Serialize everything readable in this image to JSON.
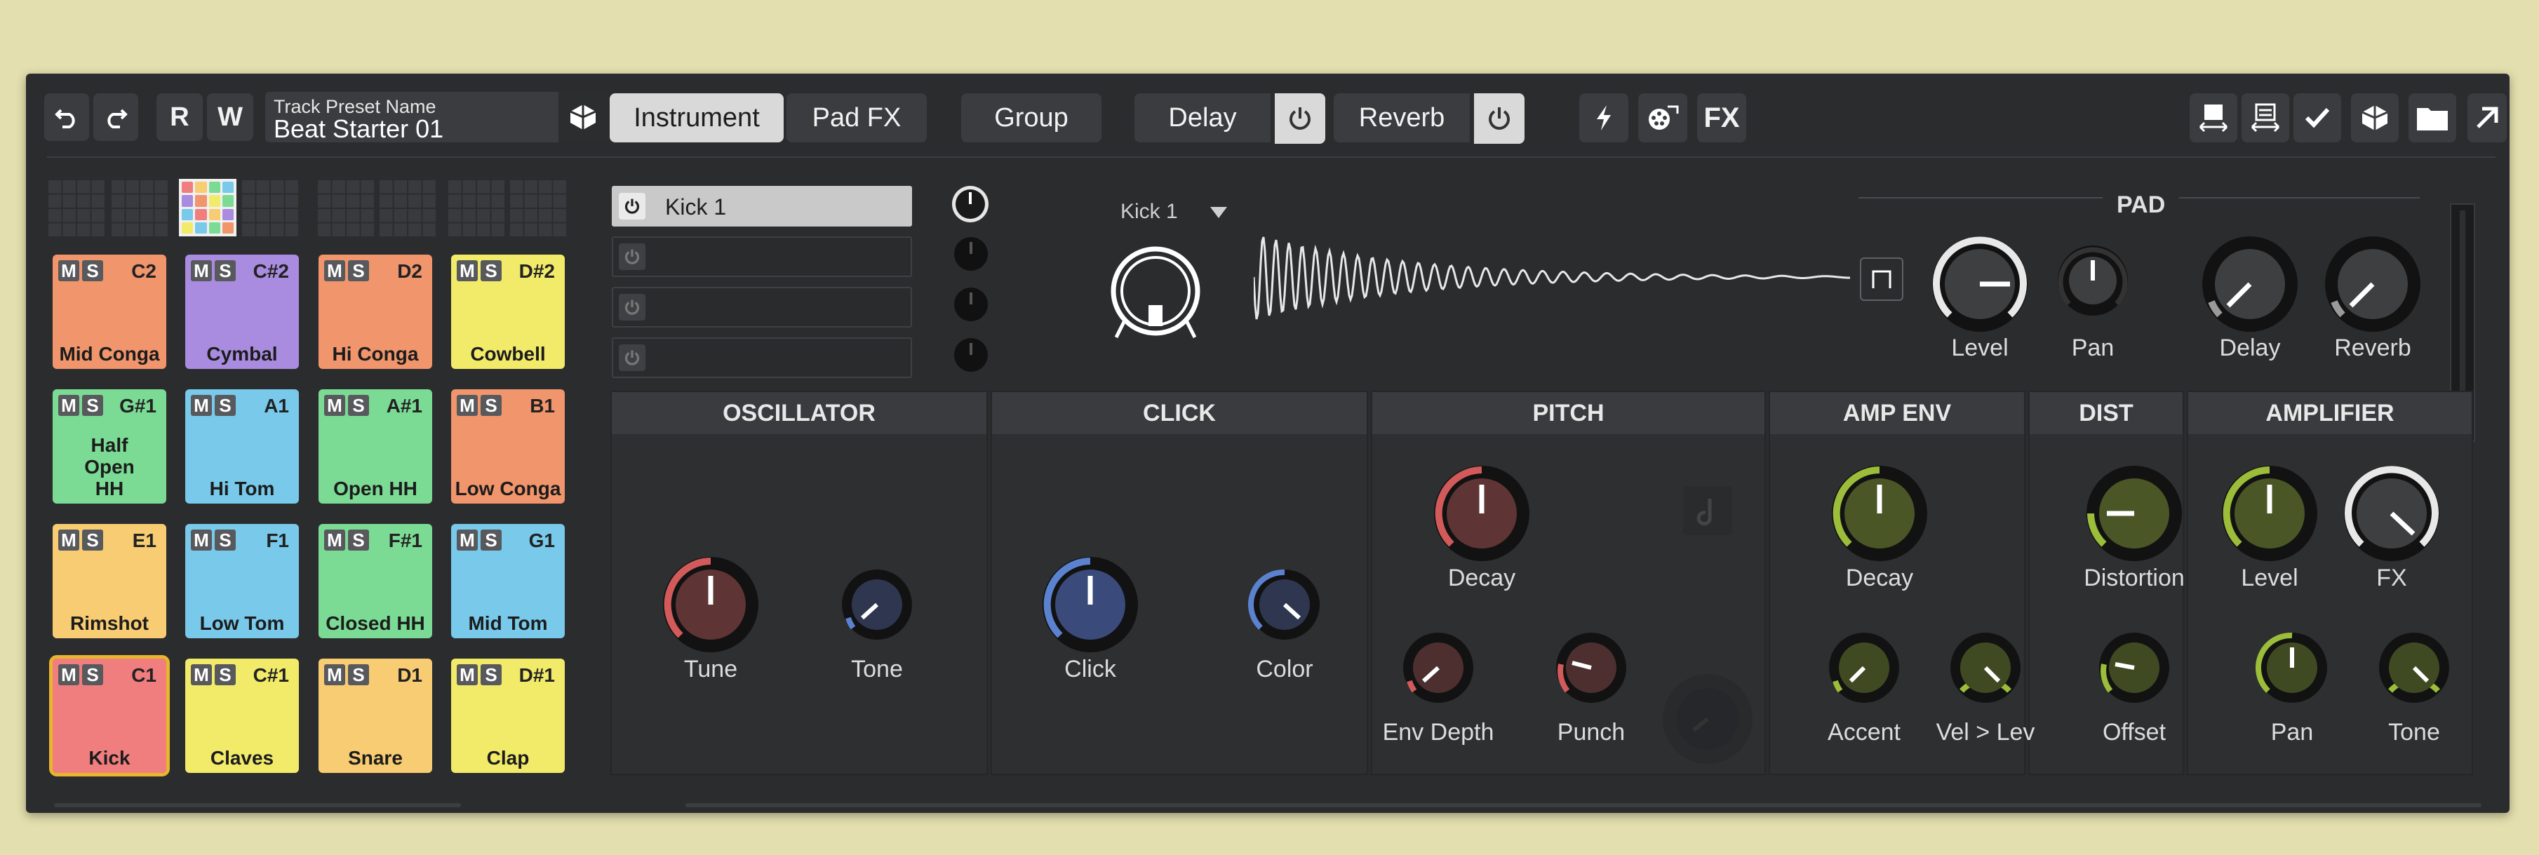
{
  "toolbar": {
    "undo_icon": "undo-icon",
    "redo_icon": "redo-icon",
    "r_label": "R",
    "w_label": "W",
    "preset_label": "Track Preset Name",
    "preset_value": "Beat Starter 01",
    "tabs": [
      "Instrument",
      "Pad FX",
      "Group",
      "Delay",
      "Reverb"
    ],
    "selected_tab": "Instrument",
    "fx_label": "FX"
  },
  "pads": [
    {
      "note": "C2",
      "name": "Mid Conga",
      "color": "#f0956c"
    },
    {
      "note": "C#2",
      "name": "Cymbal",
      "color": "#a98cdf"
    },
    {
      "note": "D2",
      "name": "Hi Conga",
      "color": "#f0956c"
    },
    {
      "note": "D#2",
      "name": "Cowbell",
      "color": "#f2eb6a"
    },
    {
      "note": "G#1",
      "name": "Half Open HH",
      "color": "#7bdb94"
    },
    {
      "note": "A1",
      "name": "Hi Tom",
      "color": "#78c9ea"
    },
    {
      "note": "A#1",
      "name": "Open HH",
      "color": "#7bdb94"
    },
    {
      "note": "B1",
      "name": "Low Conga",
      "color": "#f0956c"
    },
    {
      "note": "E1",
      "name": "Rimshot",
      "color": "#f7cc72"
    },
    {
      "note": "F1",
      "name": "Low Tom",
      "color": "#78c9ea"
    },
    {
      "note": "F#1",
      "name": "Closed HH",
      "color": "#7bdb94"
    },
    {
      "note": "G1",
      "name": "Mid Tom",
      "color": "#78c9ea"
    },
    {
      "note": "C1",
      "name": "Kick",
      "color": "#f07e7e"
    },
    {
      "note": "C#1",
      "name": "Claves",
      "color": "#f2eb6a"
    },
    {
      "note": "D1",
      "name": "Snare",
      "color": "#f7cc72"
    },
    {
      "note": "D#1",
      "name": "Clap",
      "color": "#f2eb6a"
    }
  ],
  "pad_ms": {
    "m": "M",
    "s": "S"
  },
  "active_pad": "Kick",
  "layers": [
    "Kick 1",
    "",
    "",
    ""
  ],
  "instrument": {
    "name": "Kick 1",
    "pad_section": "PAD",
    "pad_knobs": [
      "Level",
      "Pan",
      "Delay",
      "Reverb"
    ]
  },
  "sections": {
    "oscillator": {
      "title": "OSCILLATOR",
      "knobs": [
        "Tune",
        "Tone"
      ]
    },
    "click": {
      "title": "CLICK",
      "knobs": [
        "Click",
        "Color"
      ]
    },
    "pitch": {
      "title": "PITCH",
      "knobs": [
        "Decay",
        "Env Depth",
        "Punch"
      ]
    },
    "amp_env": {
      "title": "AMP ENV",
      "knobs": [
        "Decay",
        "Accent",
        "Vel > Lev"
      ]
    },
    "dist": {
      "title": "DIST",
      "knobs": [
        "Distortion",
        "Offset"
      ]
    },
    "amplifier": {
      "title": "AMPLIFIER",
      "knobs": [
        "Level",
        "FX",
        "Pan",
        "Tone"
      ]
    }
  },
  "colors": {
    "red_knob": "#d25a5a",
    "blue_knob": "#5b82cf",
    "green_knob": "#9bbd3a",
    "white_knob": "#e8e8e8",
    "gray_knob": "#9a9a9a",
    "active_pad_outline": "#e9b52e"
  }
}
